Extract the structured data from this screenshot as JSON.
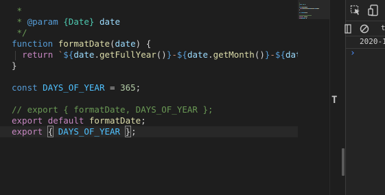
{
  "editor": {
    "lines": [
      [
        {
          "c": "cm",
          "t": " *"
        }
      ],
      [
        {
          "c": "cm",
          "t": " * "
        },
        {
          "c": "tg",
          "t": "@param"
        },
        {
          "c": "cm",
          "t": " "
        },
        {
          "c": "tp",
          "t": "{Date}"
        },
        {
          "c": "cm",
          "t": " "
        },
        {
          "c": "vr",
          "t": "date"
        }
      ],
      [
        {
          "c": "cm",
          "t": " */"
        }
      ],
      [
        {
          "c": "kw",
          "t": "function"
        },
        {
          "c": "pl",
          "t": " "
        },
        {
          "c": "fn",
          "t": "formatDate"
        },
        {
          "c": "pl",
          "t": "("
        },
        {
          "c": "vr",
          "t": "date"
        },
        {
          "c": "pl",
          "t": ") {"
        }
      ],
      [
        {
          "c": "pl",
          "t": "  "
        },
        {
          "c": "kw2",
          "t": "return"
        },
        {
          "c": "pl",
          "t": " "
        },
        {
          "c": "st",
          "t": "`"
        },
        {
          "c": "kw",
          "t": "${"
        },
        {
          "c": "vr",
          "t": "date"
        },
        {
          "c": "pl",
          "t": "."
        },
        {
          "c": "fn",
          "t": "getFullYear"
        },
        {
          "c": "pl",
          "t": "()"
        },
        {
          "c": "kw",
          "t": "}"
        },
        {
          "c": "st",
          "t": "-"
        },
        {
          "c": "kw",
          "t": "${"
        },
        {
          "c": "vr",
          "t": "date"
        },
        {
          "c": "pl",
          "t": "."
        },
        {
          "c": "fn",
          "t": "getMonth"
        },
        {
          "c": "pl",
          "t": "()"
        },
        {
          "c": "kw",
          "t": "}"
        },
        {
          "c": "st",
          "t": "-"
        },
        {
          "c": "kw",
          "t": "${"
        },
        {
          "c": "vr",
          "t": "date"
        },
        {
          "c": "pl",
          "t": "."
        },
        {
          "c": "fn",
          "t": "getDate"
        }
      ],
      [
        {
          "c": "pl",
          "t": "}"
        }
      ],
      [],
      [
        {
          "c": "kw",
          "t": "const"
        },
        {
          "c": "pl",
          "t": " "
        },
        {
          "c": "cn",
          "t": "DAYS_OF_YEAR"
        },
        {
          "c": "pl",
          "t": " = "
        },
        {
          "c": "nu",
          "t": "365"
        },
        {
          "c": "pl",
          "t": ";"
        }
      ],
      [],
      [
        {
          "c": "cm",
          "t": "// export { formatDate, DAYS_OF_YEAR };"
        }
      ],
      [
        {
          "c": "kw2",
          "t": "export"
        },
        {
          "c": "pl",
          "t": " "
        },
        {
          "c": "kw2",
          "t": "default"
        },
        {
          "c": "pl",
          "t": " "
        },
        {
          "c": "fn",
          "t": "formatDate"
        },
        {
          "c": "pl",
          "t": ";"
        }
      ],
      [
        {
          "c": "kw2",
          "t": "export"
        },
        {
          "c": "pl",
          "t": " "
        },
        {
          "c": "pl br",
          "t": "{"
        },
        {
          "c": "pl",
          "t": " "
        },
        {
          "c": "cn",
          "t": "DAYS_OF_YEAR"
        },
        {
          "c": "pl",
          "t": " "
        },
        {
          "c": "pl br",
          "t": "}"
        },
        {
          "c": "cursor",
          "t": ""
        },
        {
          "c": "pl",
          "t": ";"
        }
      ]
    ]
  },
  "scrollbar": {
    "marker": "T"
  },
  "devtools": {
    "toolbar": {
      "inspect_icon": "inspect-element-icon",
      "device_icon": "device-toolbar-icon"
    },
    "console_bar": {
      "sidebar_icon": "sidebar-toggle-icon",
      "clear_icon": "clear-console-icon",
      "context_label": "to"
    },
    "output": {
      "log_text": "2020-1"
    },
    "prompt": {
      "symbol": "›"
    }
  },
  "colors": {
    "background": "#1e1e1e",
    "comment": "#6a9955",
    "keyword": "#569cd6",
    "control_keyword": "#c586c0",
    "function": "#dcdcaa",
    "variable": "#9cdcfe",
    "constant": "#4fc1ff",
    "number": "#b5cea8",
    "string": "#ce9178",
    "type": "#4ec9b0"
  }
}
